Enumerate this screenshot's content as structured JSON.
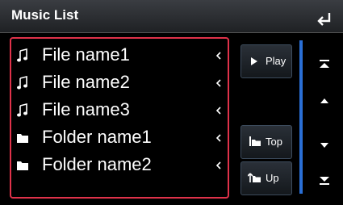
{
  "header": {
    "title": "Music List"
  },
  "list": {
    "items": [
      {
        "type": "file",
        "label": "File name1"
      },
      {
        "type": "file",
        "label": "File name2"
      },
      {
        "type": "file",
        "label": "File name3"
      },
      {
        "type": "folder",
        "label": "Folder name1"
      },
      {
        "type": "folder",
        "label": "Folder name2"
      }
    ]
  },
  "side_buttons": {
    "play": "Play",
    "top": "Top",
    "up": "Up"
  },
  "icons": {
    "back": "back-arrow-icon",
    "file": "music-note-icon",
    "folder": "folder-icon",
    "chevron": "chevron-left-icon",
    "scroll_top": "scroll-top-icon",
    "scroll_up": "scroll-up-icon",
    "scroll_down": "scroll-down-icon",
    "scroll_bottom": "scroll-bottom-icon"
  },
  "colors": {
    "highlight_border": "#e0324a",
    "scroll_track": "#2a6fd6"
  }
}
